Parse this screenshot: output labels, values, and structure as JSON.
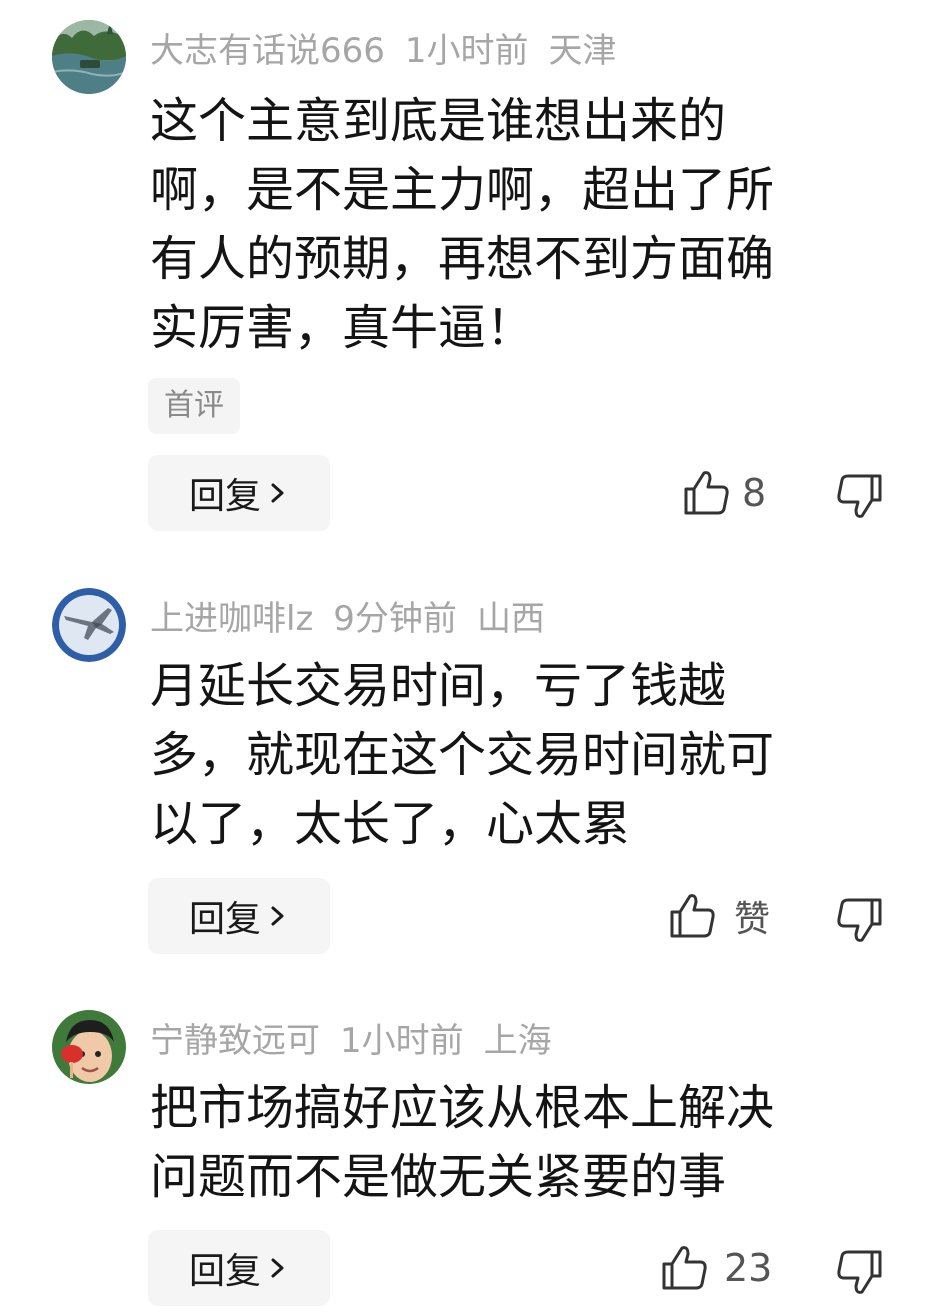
{
  "comments": [
    {
      "username": "大志有话说666",
      "time": "1小时前",
      "location": "天津",
      "text": "这个主意到底是谁想出来的\n啊，是不是主力啊，超出了所\n有人的预期，再想不到方面确\n实厉害，真牛逼！",
      "tag": "首评",
      "reply_label": "回复",
      "like_count": "8",
      "avatar_icon": "lake-scenery-avatar"
    },
    {
      "username": "上进咖啡lz",
      "time": "9分钟前",
      "location": "山西",
      "text": "月延长交易时间，亏了钱越\n多，就现在这个交易时间就可\n以了，太长了，心太累",
      "reply_label": "回复",
      "like_count": "赞",
      "avatar_icon": "fighter-jet-avatar"
    },
    {
      "username": "宁静致远可",
      "time": "1小时前",
      "location": "上海",
      "text": "把市场搞好应该从根本上解决\n问题而不是做无关紧要的事",
      "reply_label": "回复",
      "like_count": "23",
      "avatar_icon": "child-photo-avatar"
    }
  ],
  "colors": {
    "meta_text": "#a6a6a6",
    "body_text": "#141414",
    "button_bg": "#f5f5f5",
    "icon_stroke": "#333333"
  }
}
